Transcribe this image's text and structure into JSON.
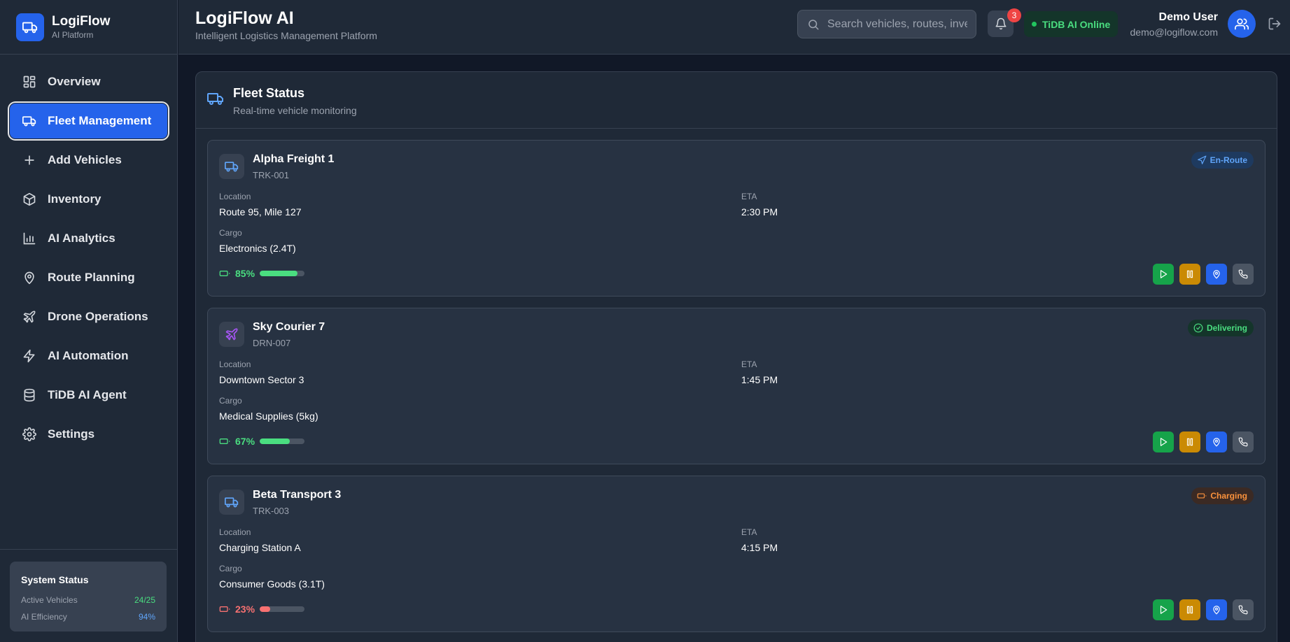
{
  "brand": {
    "name": "LogiFlow",
    "subtitle": "AI Platform"
  },
  "sidebar": {
    "items": [
      {
        "label": "Overview",
        "icon": "grid-icon"
      },
      {
        "label": "Fleet Management",
        "icon": "truck-icon",
        "active": true
      },
      {
        "label": "Add Vehicles",
        "icon": "plus-icon"
      },
      {
        "label": "Inventory",
        "icon": "package-icon"
      },
      {
        "label": "AI Analytics",
        "icon": "bar-chart-icon"
      },
      {
        "label": "Route Planning",
        "icon": "map-pin-icon"
      },
      {
        "label": "Drone Operations",
        "icon": "plane-icon"
      },
      {
        "label": "AI Automation",
        "icon": "zap-icon"
      },
      {
        "label": "TiDB AI Agent",
        "icon": "database-icon"
      },
      {
        "label": "Settings",
        "icon": "gear-icon"
      }
    ]
  },
  "system_status": {
    "title": "System Status",
    "active_vehicles_label": "Active Vehicles",
    "active_vehicles_value": "24/25",
    "ai_efficiency_label": "AI Efficiency",
    "ai_efficiency_value": "94%"
  },
  "header": {
    "title": "LogiFlow AI",
    "subtitle": "Intelligent Logistics Management Platform",
    "search_placeholder": "Search vehicles, routes, inventory...",
    "notification_count": "3",
    "tidb_status": "TiDB AI Online",
    "user_name": "Demo User",
    "user_email": "demo@logiflow.com"
  },
  "fleet": {
    "title": "Fleet Status",
    "subtitle": "Real-time vehicle monitoring",
    "location_label": "Location",
    "eta_label": "ETA",
    "cargo_label": "Cargo",
    "vehicles": [
      {
        "name": "Alpha Freight 1",
        "id": "TRK-001",
        "type": "truck",
        "status": "En-Route",
        "location": "Route 95, Mile 127",
        "eta": "2:30 PM",
        "cargo": "Electronics (2.4T)",
        "battery": "85%",
        "battery_level": 85,
        "battery_color": "#4ade80"
      },
      {
        "name": "Sky Courier 7",
        "id": "DRN-007",
        "type": "drone",
        "status": "Delivering",
        "location": "Downtown Sector 3",
        "eta": "1:45 PM",
        "cargo": "Medical Supplies (5kg)",
        "battery": "67%",
        "battery_level": 67,
        "battery_color": "#4ade80"
      },
      {
        "name": "Beta Transport 3",
        "id": "TRK-003",
        "type": "truck",
        "status": "Charging",
        "location": "Charging Station A",
        "eta": "4:15 PM",
        "cargo": "Consumer Goods (3.1T)",
        "battery": "23%",
        "battery_level": 23,
        "battery_color": "#f87171"
      }
    ]
  }
}
